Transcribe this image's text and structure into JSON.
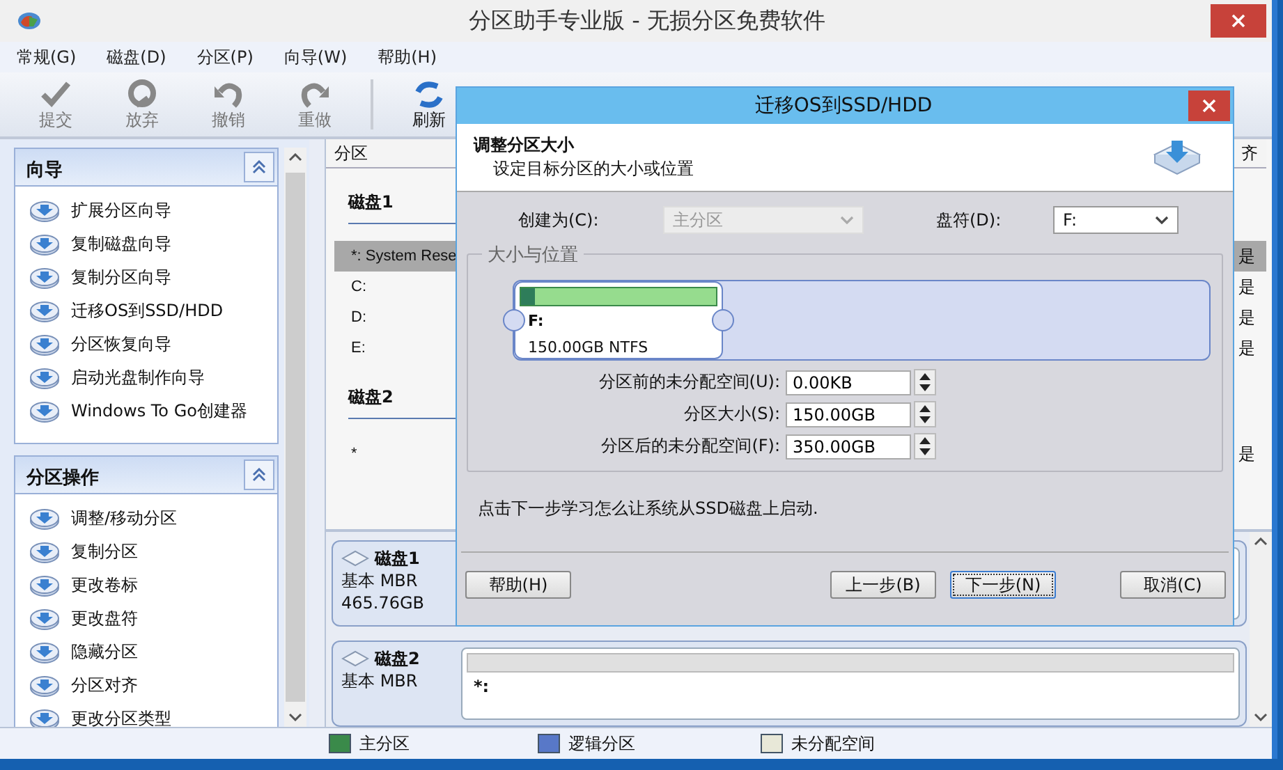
{
  "window": {
    "title": "分区助手专业版 - 无损分区免费软件"
  },
  "menu": [
    {
      "label": "常规(G)"
    },
    {
      "label": "磁盘(D)"
    },
    {
      "label": "分区(P)"
    },
    {
      "label": "向导(W)"
    },
    {
      "label": "帮助(H)"
    }
  ],
  "toolbar": [
    {
      "label": "提交",
      "kind": "check",
      "disabled": true
    },
    {
      "label": "放弃",
      "kind": "discard",
      "disabled": true
    },
    {
      "label": "撤销",
      "kind": "undo",
      "disabled": true
    },
    {
      "label": "重做",
      "kind": "redo",
      "disabled": true
    },
    {
      "label": "刷新",
      "kind": "refresh",
      "disabled": false
    }
  ],
  "sidebar": {
    "panels": [
      {
        "title": "向导",
        "expanded": true,
        "items": [
          {
            "label": "扩展分区向导"
          },
          {
            "label": "复制磁盘向导"
          },
          {
            "label": "复制分区向导"
          },
          {
            "label": "迁移OS到SSD/HDD"
          },
          {
            "label": "分区恢复向导"
          },
          {
            "label": "启动光盘制作向导"
          },
          {
            "label": "Windows To Go创建器"
          }
        ]
      },
      {
        "title": "分区操作",
        "expanded": true,
        "items": [
          {
            "label": "调整/移动分区"
          },
          {
            "label": "复制分区"
          },
          {
            "label": "更改卷标"
          },
          {
            "label": "更改盘符"
          },
          {
            "label": "隐藏分区"
          },
          {
            "label": "分区对齐"
          },
          {
            "label": "更改分区类型"
          }
        ]
      }
    ]
  },
  "partition_list": {
    "columns": [
      {
        "label": "分区"
      },
      {
        "label": "齐"
      }
    ],
    "disks": [
      {
        "title": "磁盘1",
        "rows": [
          {
            "name": "*: System Rese",
            "column_2": "是",
            "selected": true
          },
          {
            "name": "C:",
            "column_2": "是",
            "selected": false
          },
          {
            "name": "D:",
            "column_2": "是",
            "selected": false
          },
          {
            "name": "E:",
            "column_2": "是",
            "selected": false
          }
        ]
      },
      {
        "title": "磁盘2",
        "rows": [
          {
            "name": "*",
            "column_2": "是",
            "selected": false
          }
        ]
      }
    ]
  },
  "disk_map": [
    {
      "title": "磁盘1",
      "type": "基本 MBR",
      "size": "465.76GB"
    },
    {
      "title": "磁盘2",
      "type": "基本 MBR",
      "partition": "*:"
    }
  ],
  "legend": [
    {
      "label": "主分区",
      "color": "#3a8a4a"
    },
    {
      "label": "逻辑分区",
      "color": "#5878c8"
    },
    {
      "label": "未分配空间",
      "color": "#e8e8d8"
    }
  ],
  "dialog": {
    "title": "迁移OS到SSD/HDD",
    "heading": "调整分区大小",
    "subheading": "设定目标分区的大小或位置",
    "create_as": {
      "label": "创建为(C):",
      "value": "主分区",
      "disabled": true
    },
    "drive_letter": {
      "label": "盘符(D):",
      "value": "F:",
      "disabled": false
    },
    "group_title": "大小与位置",
    "partition_bar": {
      "label": "F:",
      "detail": "150.00GB NTFS",
      "usage": {
        "level": 0.07
      }
    },
    "spinners": [
      {
        "label": "分区前的未分配空间(U):",
        "value": "0.00KB"
      },
      {
        "label": "分区大小(S):",
        "value": "150.00GB"
      },
      {
        "label": "分区后的未分配空间(F):",
        "value": "350.00GB"
      }
    ],
    "note": "点击下一步学习怎么让系统从SSD磁盘上启动.",
    "buttons": [
      {
        "label": "帮助(H)",
        "kind": "left",
        "default": false
      },
      {
        "label": "上一步(B)",
        "kind": "right",
        "default": false
      },
      {
        "label": "下一步(N)",
        "kind": "right",
        "default": true
      },
      {
        "label": "取消(C)",
        "kind": "far",
        "default": false
      }
    ]
  }
}
